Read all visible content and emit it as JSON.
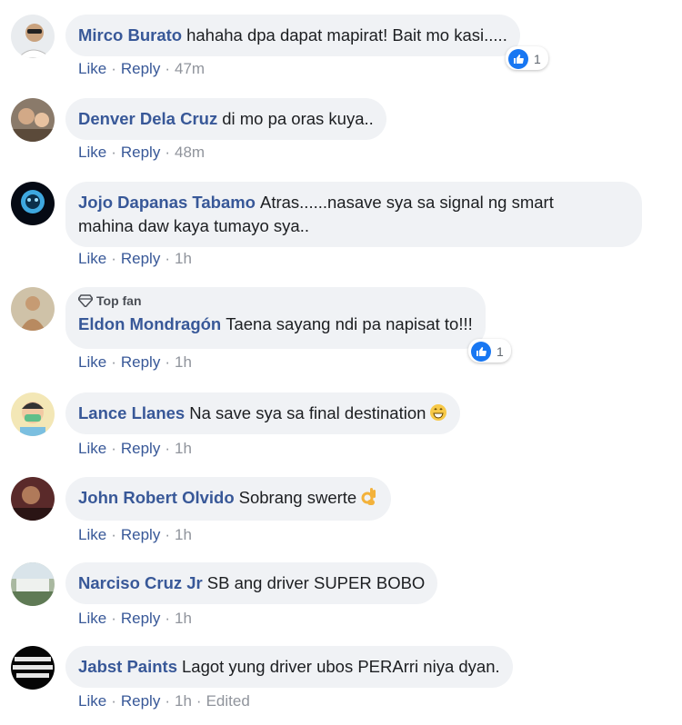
{
  "actions": {
    "like": "Like",
    "reply": "Reply",
    "dot": "·",
    "edited": "Edited"
  },
  "badges": {
    "top_fan": "Top fan"
  },
  "colors": {
    "author": "#385898",
    "bubble_bg": "#f0f2f5",
    "like_blue": "#1877f2",
    "meta_gray": "#90949c"
  },
  "comments": [
    {
      "author": "Mirco Burato",
      "text": "hahaha dpa dapat mapirat! Bait mo kasi.....",
      "time": "47m",
      "reaction_count": "1",
      "reaction_icon": "like-icon"
    },
    {
      "author": "Denver Dela Cruz",
      "text": "di mo pa oras kuya..",
      "time": "48m"
    },
    {
      "author": "Jojo Dapanas Tabamo",
      "text": "Atras......nasave sya sa signal ng smart",
      "text2": "mahina daw kaya tumayo sya..",
      "time": "1h"
    },
    {
      "author": "Eldon Mondragón",
      "text": "Taena sayang ndi pa napisat to!!!",
      "time": "1h",
      "reaction_count": "1",
      "reaction_icon": "like-icon",
      "top_fan": true
    },
    {
      "author": "Lance Llanes",
      "text": "Na save sya sa final destination",
      "time": "1h",
      "emoji": "grinning-face-emoji"
    },
    {
      "author": "John Robert Olvido",
      "text": "Sobrang swerte",
      "time": "1h",
      "emoji": "ok-hand-emoji"
    },
    {
      "author": "Narciso Cruz Jr",
      "text": "SB ang driver SUPER BOBO",
      "time": "1h"
    },
    {
      "author": "Jabst Paints",
      "text": "Lagot yung driver ubos PERArri niya dyan.",
      "time": "1h",
      "edited": true
    }
  ]
}
